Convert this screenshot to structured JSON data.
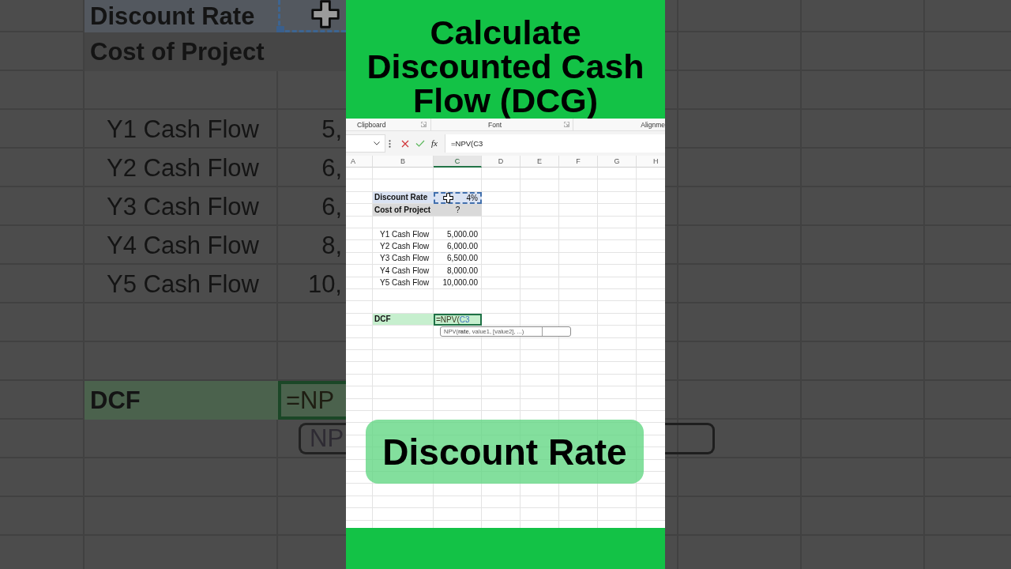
{
  "backdrop_left": {
    "rows": [
      {
        "kind": "input",
        "label": "Discount Rate",
        "selected": false,
        "marked": true,
        "pointer": true
      },
      {
        "kind": "total",
        "label": "Cost of Project",
        "selected": false,
        "marked": false,
        "pointer": false
      },
      {
        "kind": "blank"
      },
      {
        "kind": "plain",
        "label": "Y1 Cash Flow",
        "value": "5,",
        "selected": false,
        "marked": false,
        "pointer": false
      },
      {
        "kind": "plain",
        "label": "Y2 Cash Flow",
        "value": "6,",
        "selected": false,
        "marked": false,
        "pointer": false
      },
      {
        "kind": "plain",
        "label": "Y3 Cash Flow",
        "value": "6,",
        "selected": false,
        "marked": false,
        "pointer": false
      },
      {
        "kind": "plain",
        "label": "Y4 Cash Flow",
        "value": "8,",
        "selected": false,
        "marked": false,
        "pointer": false
      },
      {
        "kind": "plain",
        "label": "Y5 Cash Flow",
        "value": "10,",
        "selected": false,
        "marked": false,
        "pointer": false
      },
      {
        "kind": "blank"
      },
      {
        "kind": "blank"
      },
      {
        "kind": "result",
        "label": "DCF",
        "value": "=NP",
        "selected": true,
        "marked": false,
        "pointer": false
      }
    ],
    "tooltip": "NP"
  },
  "banner": {
    "title": "Calculate Discounted Cash Flow (DCG)"
  },
  "ribbon": {
    "groups": [
      {
        "label": "Clipboard",
        "launcher": true
      },
      {
        "label": "Font",
        "launcher": true
      },
      {
        "label": "Alignme",
        "launcher": false
      }
    ]
  },
  "formula_bar": {
    "function_button": "fx",
    "formula": "=NPV(C3"
  },
  "sheet": {
    "columns": [
      {
        "label": "A",
        "selected": false
      },
      {
        "label": "B",
        "selected": false
      },
      {
        "label": "C",
        "selected": true
      },
      {
        "label": "D",
        "selected": false
      },
      {
        "label": "E",
        "selected": false
      },
      {
        "label": "F",
        "selected": false
      },
      {
        "label": "G",
        "selected": false
      },
      {
        "label": "H",
        "selected": false
      }
    ],
    "rows": [
      {
        "kind": "blank"
      },
      {
        "kind": "blank"
      },
      {
        "kind": "input",
        "label": "Discount Rate",
        "value": "4%",
        "selected": false,
        "marked": true,
        "pointer": true
      },
      {
        "kind": "total",
        "label": "Cost of Project",
        "value": "?",
        "selected": false,
        "marked": false,
        "pointer": false
      },
      {
        "kind": "blank"
      },
      {
        "kind": "plain",
        "label": "Y1 Cash Flow",
        "value": "5,000.00",
        "selected": false,
        "marked": false,
        "pointer": false
      },
      {
        "kind": "plain",
        "label": "Y2 Cash Flow",
        "value": "6,000.00",
        "selected": false,
        "marked": false,
        "pointer": false
      },
      {
        "kind": "plain",
        "label": "Y3 Cash Flow",
        "value": "6,500.00",
        "selected": false,
        "marked": false,
        "pointer": false
      },
      {
        "kind": "plain",
        "label": "Y4 Cash Flow",
        "value": "8,000.00",
        "selected": false,
        "marked": false,
        "pointer": false
      },
      {
        "kind": "plain",
        "label": "Y5 Cash Flow",
        "value": "10,000.00",
        "selected": false,
        "marked": false,
        "pointer": false
      },
      {
        "kind": "blank"
      },
      {
        "kind": "blank"
      },
      {
        "kind": "result",
        "label": "DCF",
        "parts": [
          {
            "kind": "text",
            "text": "=NPV("
          },
          {
            "kind": "reference",
            "text": "C3"
          }
        ],
        "selected": true,
        "marked": false,
        "pointer": false
      }
    ],
    "tooltip": "NPV(**rate**, value1, [value2], ...)"
  },
  "caption": "Discount Rate"
}
